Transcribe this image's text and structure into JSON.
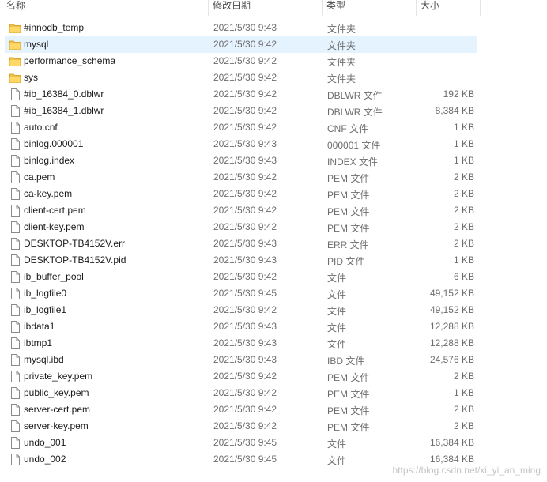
{
  "columns": {
    "name": "名称",
    "modified": "修改日期",
    "type": "类型",
    "size": "大小"
  },
  "watermark": "https://blog.csdn.net/xi_yi_an_ming",
  "files": [
    {
      "name": "#innodb_temp",
      "modified": "2021/5/30 9:43",
      "type": "文件夹",
      "size": "",
      "icon": "folder-icon"
    },
    {
      "name": "mysql",
      "modified": "2021/5/30 9:42",
      "type": "文件夹",
      "size": "",
      "icon": "folder-icon",
      "selected": true
    },
    {
      "name": "performance_schema",
      "modified": "2021/5/30 9:42",
      "type": "文件夹",
      "size": "",
      "icon": "folder-icon"
    },
    {
      "name": "sys",
      "modified": "2021/5/30 9:42",
      "type": "文件夹",
      "size": "",
      "icon": "folder-icon"
    },
    {
      "name": "#ib_16384_0.dblwr",
      "modified": "2021/5/30 9:42",
      "type": "DBLWR 文件",
      "size": "192 KB",
      "icon": "file-icon"
    },
    {
      "name": "#ib_16384_1.dblwr",
      "modified": "2021/5/30 9:42",
      "type": "DBLWR 文件",
      "size": "8,384 KB",
      "icon": "file-icon"
    },
    {
      "name": "auto.cnf",
      "modified": "2021/5/30 9:42",
      "type": "CNF 文件",
      "size": "1 KB",
      "icon": "file-icon"
    },
    {
      "name": "binlog.000001",
      "modified": "2021/5/30 9:43",
      "type": "000001 文件",
      "size": "1 KB",
      "icon": "file-icon"
    },
    {
      "name": "binlog.index",
      "modified": "2021/5/30 9:43",
      "type": "INDEX 文件",
      "size": "1 KB",
      "icon": "file-icon"
    },
    {
      "name": "ca.pem",
      "modified": "2021/5/30 9:42",
      "type": "PEM 文件",
      "size": "2 KB",
      "icon": "file-icon"
    },
    {
      "name": "ca-key.pem",
      "modified": "2021/5/30 9:42",
      "type": "PEM 文件",
      "size": "2 KB",
      "icon": "file-icon"
    },
    {
      "name": "client-cert.pem",
      "modified": "2021/5/30 9:42",
      "type": "PEM 文件",
      "size": "2 KB",
      "icon": "file-icon"
    },
    {
      "name": "client-key.pem",
      "modified": "2021/5/30 9:42",
      "type": "PEM 文件",
      "size": "2 KB",
      "icon": "file-icon"
    },
    {
      "name": "DESKTOP-TB4152V.err",
      "modified": "2021/5/30 9:43",
      "type": "ERR 文件",
      "size": "2 KB",
      "icon": "file-icon"
    },
    {
      "name": "DESKTOP-TB4152V.pid",
      "modified": "2021/5/30 9:43",
      "type": "PID 文件",
      "size": "1 KB",
      "icon": "file-icon"
    },
    {
      "name": "ib_buffer_pool",
      "modified": "2021/5/30 9:42",
      "type": "文件",
      "size": "6 KB",
      "icon": "file-icon"
    },
    {
      "name": "ib_logfile0",
      "modified": "2021/5/30 9:45",
      "type": "文件",
      "size": "49,152 KB",
      "icon": "file-icon"
    },
    {
      "name": "ib_logfile1",
      "modified": "2021/5/30 9:42",
      "type": "文件",
      "size": "49,152 KB",
      "icon": "file-icon"
    },
    {
      "name": "ibdata1",
      "modified": "2021/5/30 9:43",
      "type": "文件",
      "size": "12,288 KB",
      "icon": "file-icon"
    },
    {
      "name": "ibtmp1",
      "modified": "2021/5/30 9:43",
      "type": "文件",
      "size": "12,288 KB",
      "icon": "file-icon"
    },
    {
      "name": "mysql.ibd",
      "modified": "2021/5/30 9:43",
      "type": "IBD 文件",
      "size": "24,576 KB",
      "icon": "file-icon"
    },
    {
      "name": "private_key.pem",
      "modified": "2021/5/30 9:42",
      "type": "PEM 文件",
      "size": "2 KB",
      "icon": "file-icon"
    },
    {
      "name": "public_key.pem",
      "modified": "2021/5/30 9:42",
      "type": "PEM 文件",
      "size": "1 KB",
      "icon": "file-icon"
    },
    {
      "name": "server-cert.pem",
      "modified": "2021/5/30 9:42",
      "type": "PEM 文件",
      "size": "2 KB",
      "icon": "file-icon"
    },
    {
      "name": "server-key.pem",
      "modified": "2021/5/30 9:42",
      "type": "PEM 文件",
      "size": "2 KB",
      "icon": "file-icon"
    },
    {
      "name": "undo_001",
      "modified": "2021/5/30 9:45",
      "type": "文件",
      "size": "16,384 KB",
      "icon": "file-icon"
    },
    {
      "name": "undo_002",
      "modified": "2021/5/30 9:45",
      "type": "文件",
      "size": "16,384 KB",
      "icon": "file-icon"
    }
  ]
}
